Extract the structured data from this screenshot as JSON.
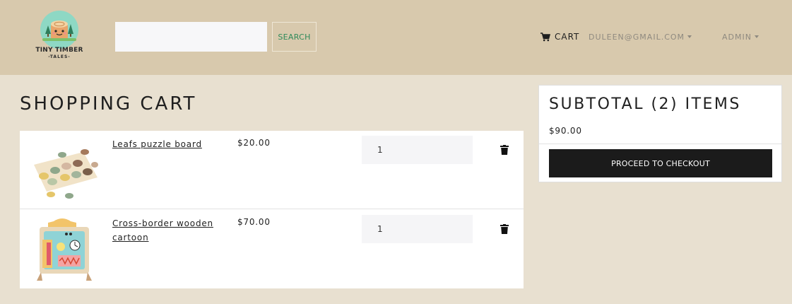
{
  "header": {
    "logo": {
      "line1": "TINY TIMBER",
      "line2": "-TALES-"
    },
    "search": {
      "value": "",
      "placeholder": "",
      "button_label": "SEARCH"
    },
    "nav": {
      "cart_label": "CART",
      "cart_icon": "shopping-cart-icon",
      "user_label": "DULEEN@GMAIL.COM",
      "admin_label": "ADMIN"
    }
  },
  "main": {
    "title": "SHOPPING CART",
    "items": [
      {
        "name": "Leafs puzzle board",
        "price": "$20.00",
        "quantity": "1",
        "image": "leaf-puzzle-board-image"
      },
      {
        "name": "Cross-border wooden cartoon",
        "price": "$70.00",
        "quantity": "1",
        "image": "wooden-busy-board-image"
      }
    ]
  },
  "summary": {
    "title": "SUBTOTAL (2) ITEMS",
    "total": "$90.00",
    "checkout_label": "PROCEED TO CHECKOUT"
  },
  "colors": {
    "header_bg": "#d8c9ad",
    "page_bg": "#e8e0d0",
    "search_accent": "#2f8a5a",
    "checkout_bg": "#1b1b1b"
  }
}
